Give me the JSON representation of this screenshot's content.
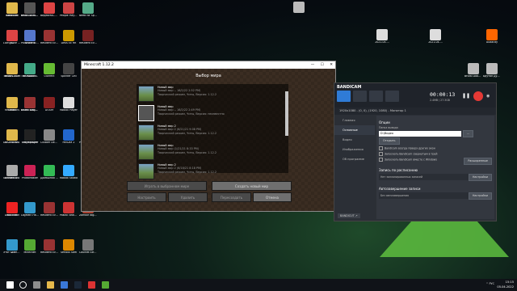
{
  "desktop_icons": [
    {
      "label": "Bandicam",
      "color": "#d33"
    },
    {
      "label": "BD",
      "color": "#e0b84b"
    },
    {
      "label": "BRAIN OUT",
      "color": "#c33"
    },
    {
      "label": "Steam",
      "color": "#1b2838"
    },
    {
      "label": "DOOM ETERNAL",
      "color": "#a22"
    },
    {
      "label": "Dishonored",
      "color": "#822"
    },
    {
      "label": "Doodle Run",
      "color": "#6a3"
    },
    {
      "label": "2",
      "color": "#e0b84b"
    },
    {
      "label": "Revo Uninstaller",
      "color": "#c33"
    },
    {
      "label": "Paint the Town Red",
      "color": "#a33"
    },
    {
      "label": "The Walking Dead",
      "color": "#553"
    },
    {
      "label": "Exiled Kingdoms",
      "color": "#777"
    },
    {
      "label": "Singleplayer",
      "color": "#2a7"
    },
    {
      "label": "PhotoMaster",
      "color": "#c25"
    },
    {
      "label": "LogMeIn Hamachi",
      "color": "#39c"
    },
    {
      "label": "Minecraft",
      "color": "#5a3"
    },
    {
      "label": "ВидеоМАСТЕР",
      "color": "#d44"
    },
    {
      "label": "Resident Evil 3",
      "color": "#933"
    },
    {
      "label": "uTorrent",
      "color": "#6b3"
    },
    {
      "label": "DOOM",
      "color": "#822"
    },
    {
      "label": "Custom Doodle",
      "color": "#888"
    },
    {
      "label": "Домашняя Фотостудия",
      "color": "#3b5"
    },
    {
      "label": "Resident Evil 2 - Claire",
      "color": "#933"
    },
    {
      "label": "Resident Evil 2 - Leon",
      "color": "#933"
    },
    {
      "label": "People Playground",
      "color": "#c44"
    },
    {
      "label": "Deus Ex HR",
      "color": "#c90"
    },
    {
      "label": "Splinter Cell",
      "color": "#444"
    },
    {
      "label": "Roblox Player",
      "color": "#ddd"
    },
    {
      "label": "PAYDAY 2",
      "color": "#26c"
    },
    {
      "label": "Roblox Studio",
      "color": "#3af"
    },
    {
      "label": "Postal: Brain Damaged",
      "color": "#c33"
    },
    {
      "label": "Serious Sam",
      "color": "#d80"
    },
    {
      "label": "Need for Speed",
      "color": "#5a8"
    },
    {
      "label": "Resident Evil 7",
      "color": "#722"
    },
    {
      "label": "Unturned",
      "color": "#9ab"
    },
    {
      "label": "Hitman 2",
      "color": "#fff"
    },
    {
      "label": "PAYDAY: The Heist",
      "color": "#b33"
    },
    {
      "label": "X-Rayzor",
      "color": "#6c6"
    },
    {
      "label": "Zombie Night Terror",
      "color": "#a43"
    },
    {
      "label": "Counter-Strike 1.6",
      "color": "#777"
    },
    {
      "label": "Sanctum",
      "color": "#e0b84b"
    },
    {
      "label": "Living Live Scenes",
      "color": "#d44"
    },
    {
      "label": "Brutal DOOM",
      "color": "#e0b84b"
    },
    {
      "label": "hellmisions",
      "color": "#e0b84b"
    },
    {
      "label": "lv — копия",
      "color": "#e0b84b"
    },
    {
      "label": "Ultimate Doom",
      "color": "#aaa"
    },
    {
      "label": "YouTube",
      "color": "#e22"
    },
    {
      "label": "Этот компьютер",
      "color": "#39c"
    },
    {
      "label": "Brutal DOOM ENHANCED",
      "color": "#555"
    },
    {
      "label": "Discord",
      "color": "#57c"
    },
    {
      "label": "BlueStacks",
      "color": "#4a8"
    },
    {
      "label": "Brutal Doom Black Edition",
      "color": "#933"
    },
    {
      "label": "The Punisher",
      "color": "#222"
    }
  ],
  "right_icons": [
    {
      "label": "",
      "color": "#bbb"
    },
    {
      "label": "2021-05-...",
      "color": "#ddd"
    },
    {
      "label": "2021-04-...",
      "color": "#ddd"
    },
    {
      "label": "Audacity",
      "color": "#f60"
    },
    {
      "label": "Brutal Doom v21 PCE",
      "color": "#bbb"
    },
    {
      "label": "Брутал Дум V21 ПСЕ",
      "color": "#bbb"
    }
  ],
  "minecraft": {
    "title": "Minecraft 1.12.2",
    "heading": "Выбор мира",
    "worlds": [
      {
        "name": "Новый мир",
        "date": "Новый мир -- 16/2/22 2:52 PM)",
        "mode": "Творческий режим, Читы, Версия: 1.12.2"
      },
      {
        "name": "Новый мир",
        "date": "Новый мир -- 16/2/22 2:49 PM)",
        "mode": "Творческий режим, Читы, Версия: неизвестно"
      },
      {
        "name": "Новый мир 2",
        "date": "Новый мир 2 (6/21/21 9:08 PM)",
        "mode": "Творческий режим, Читы, Версия: 1.12.2"
      },
      {
        "name": "Новый мир",
        "date": "Новый мир (1/21/21 8:33 PM)",
        "mode": "Творческий режим, Читы, Версия: 1.12.2"
      },
      {
        "name": "Новый мир 2",
        "date": "Новый мир 2 (6/18/21 8:18 PM)",
        "mode": "Творческий режим, Читы, Версия: 1.12.2"
      }
    ],
    "btn_play": "Играть в выбранном мире",
    "btn_create": "Создать новый мир",
    "btn_edit": "Настроить",
    "btn_delete": "Удалить",
    "btn_recreate": "Пересоздать",
    "btn_cancel": "Отмена"
  },
  "bandicam": {
    "logo": "BANDICAM",
    "time": "00:00:13",
    "size": "2.4MB / 27.3GB",
    "resolution": "1920x1080 - (0, 0), (1920, 1080) - Монитор 1",
    "nav": [
      "Главная",
      "Основные",
      "Видео",
      "Изображения",
      "Об программе"
    ],
    "options_heading": "Опции",
    "output_folder_label": "Папка вывода",
    "output_folder_value": "D:\\Видео",
    "btn_browse": "...",
    "btn_open": "Открыть",
    "opt1": "Bandicam всегда поверх других окон",
    "opt2": "Запускать Bandicam свернутым в трей",
    "opt3": "Запускать Bandicam вместе с Windows",
    "btn_advanced": "Расширенные",
    "schedule_heading": "Запись по расписанию",
    "schedule_value": "Нет запланированных записей",
    "btn_settings1": "Настройки",
    "autostart_heading": "Автозавершение записи",
    "autostart_value": "Без автозавершения",
    "btn_settings2": "Настройки",
    "footer": "BANDICUT ↗"
  },
  "taskbar": {
    "time": "15:15",
    "date": "05.04.2022",
    "tray": "^ РУС"
  }
}
